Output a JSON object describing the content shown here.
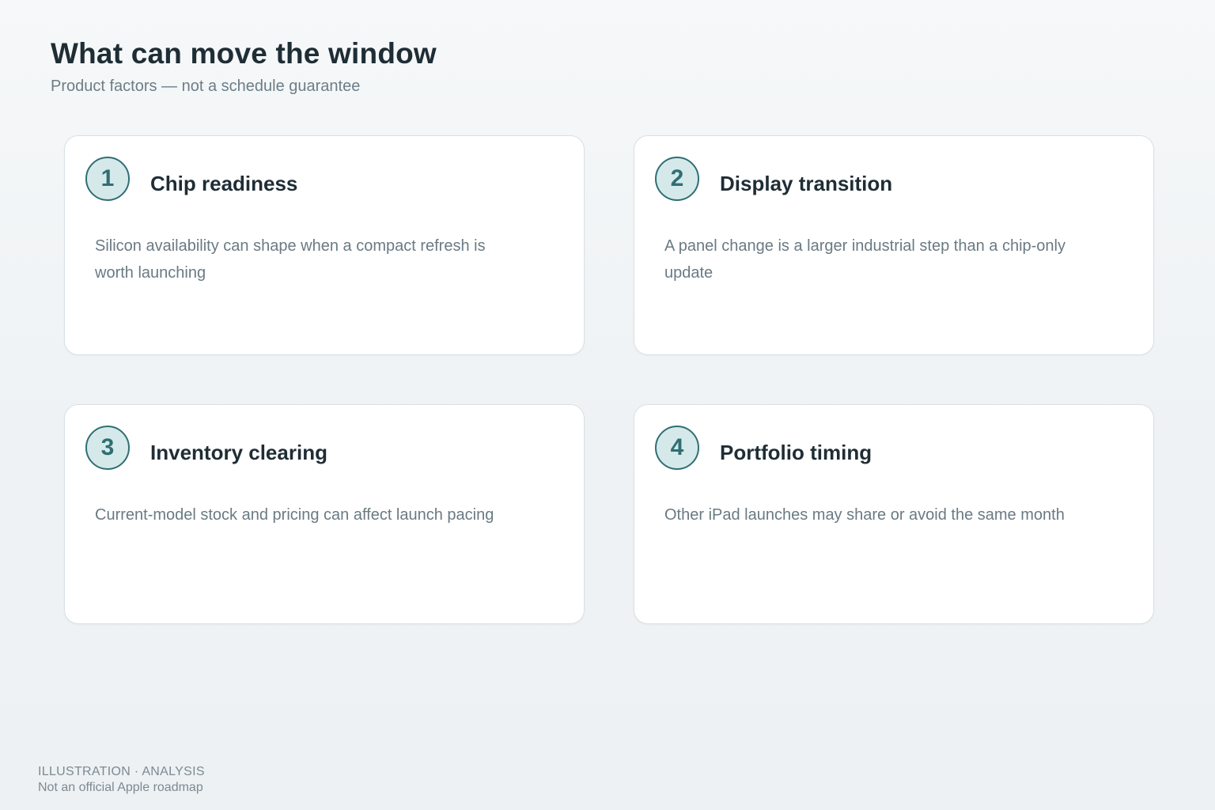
{
  "header": {
    "title": "What can move the window",
    "subtitle": "Product factors — not a schedule guarantee"
  },
  "cards": [
    {
      "number": "1",
      "title": "Chip readiness",
      "body": "Silicon availability can shape when a compact refresh is worth launching"
    },
    {
      "number": "2",
      "title": "Display transition",
      "body": "A panel change is a larger industrial step than a chip-only update"
    },
    {
      "number": "3",
      "title": "Inventory clearing",
      "body": "Current-model stock and pricing can affect launch pacing"
    },
    {
      "number": "4",
      "title": "Portfolio timing",
      "body": "Other iPad launches may share or avoid the same month"
    }
  ],
  "footer": {
    "label": "ILLUSTRATION · ANALYSIS",
    "note": "Not an official Apple roadmap"
  },
  "colors": {
    "accent": "#2f6f73",
    "badge_fill": "#d6e9ea",
    "text_dark": "#1f2d35",
    "text_muted": "#6a7a83"
  }
}
